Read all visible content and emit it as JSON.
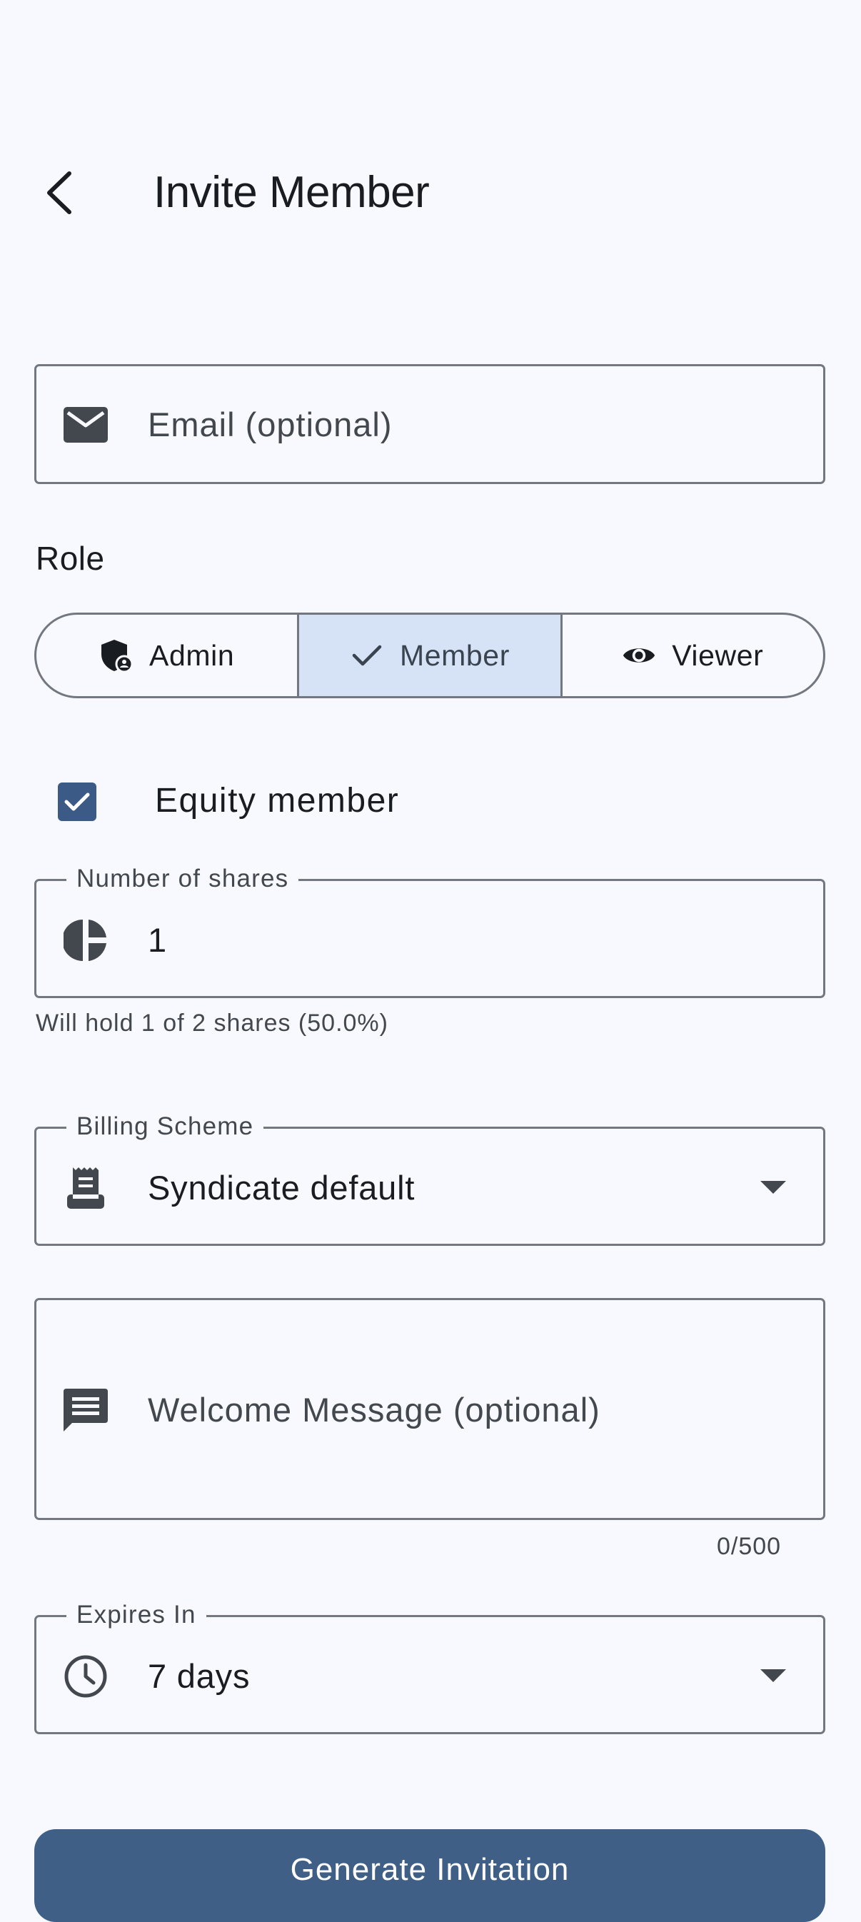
{
  "header": {
    "title": "Invite Member"
  },
  "email": {
    "placeholder": "Email (optional)"
  },
  "role": {
    "label": "Role",
    "options": [
      {
        "label": "Admin",
        "icon": "admin-shield-icon",
        "selected": false
      },
      {
        "label": "Member",
        "icon": "check-icon",
        "selected": true
      },
      {
        "label": "Viewer",
        "icon": "eye-icon",
        "selected": false
      }
    ]
  },
  "equity": {
    "label": "Equity member",
    "checked": true
  },
  "shares": {
    "label": "Number of shares",
    "value": "1",
    "helper": "Will hold 1 of 2 shares (50.0%)",
    "icon": "pie-chart-icon"
  },
  "billing": {
    "label": "Billing Scheme",
    "value": "Syndicate default",
    "icon": "receipt-icon"
  },
  "welcome": {
    "placeholder": "Welcome Message (optional)",
    "counter": "0/500",
    "icon": "message-icon"
  },
  "expires": {
    "label": "Expires In",
    "value": "7 days",
    "icon": "clock-icon"
  },
  "actions": {
    "generate_label": "Generate Invitation"
  },
  "colors": {
    "background": "#f8f9ff",
    "primary": "#3f5f86",
    "checkbox": "#3b5a86",
    "segment_selected": "#d6e3f7",
    "outline": "#73777f",
    "text": "#191c20",
    "text_secondary": "#43474e"
  }
}
